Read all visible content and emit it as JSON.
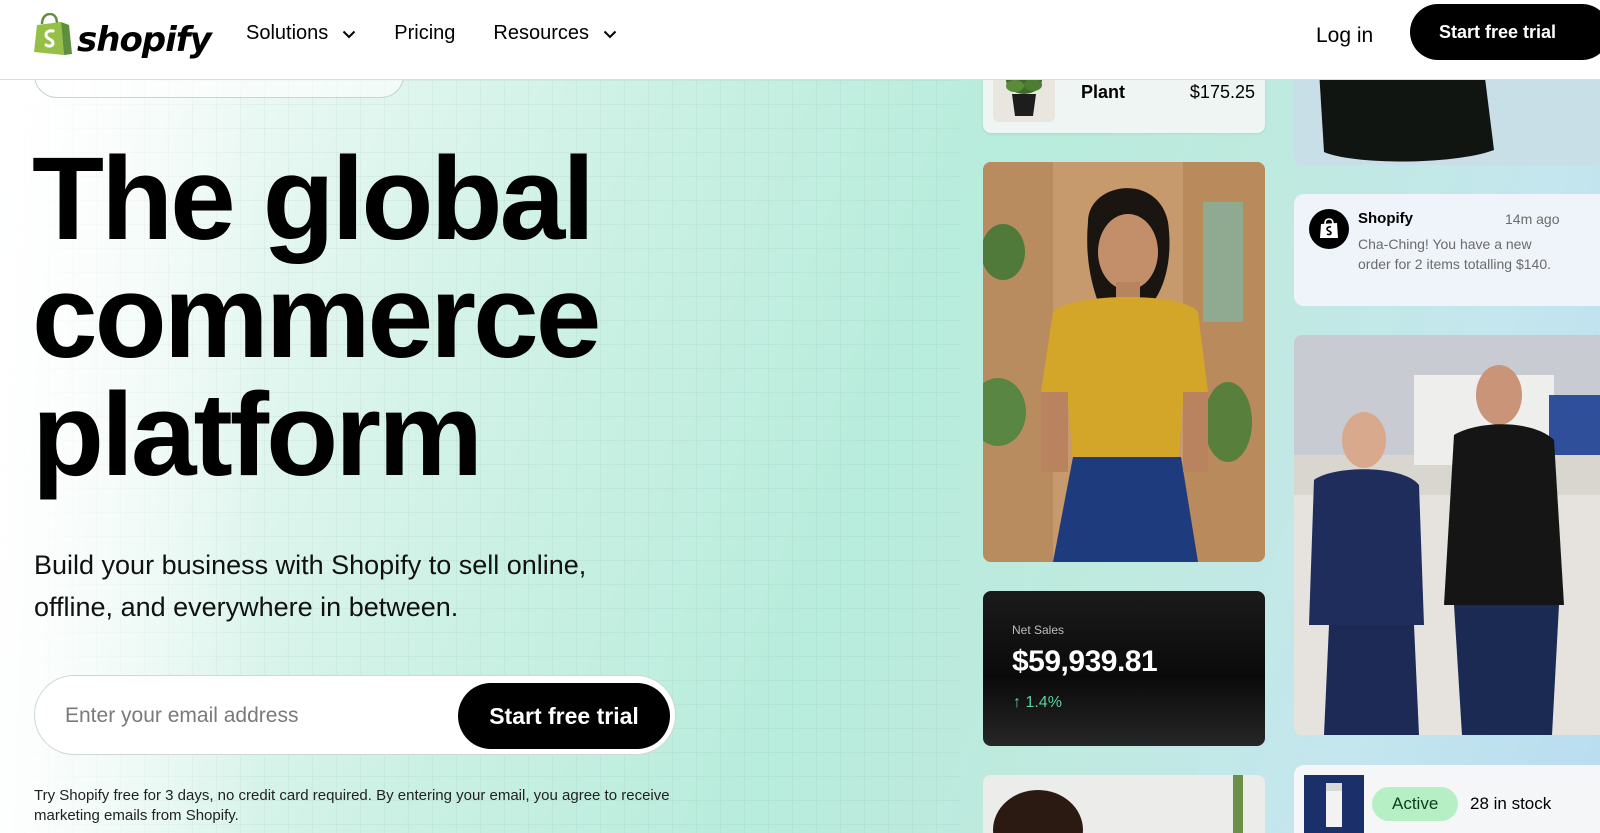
{
  "brand": {
    "name": "shopify",
    "colors": {
      "logo_green": "#95bf47",
      "logo_dark_green": "#5e8e3e",
      "primary_button": "#000000",
      "positive": "#5fd09b",
      "active_badge": "#b6efc4"
    }
  },
  "nav": {
    "items": [
      {
        "label": "Solutions",
        "has_dropdown": true
      },
      {
        "label": "Pricing",
        "has_dropdown": false
      },
      {
        "label": "Resources",
        "has_dropdown": true
      }
    ],
    "login_label": "Log in",
    "cta_label": "Start free trial"
  },
  "hero": {
    "title_lines": [
      "The global",
      "commerce",
      "platform"
    ],
    "subtitle_lines": [
      "Build your business with Shopify to sell online,",
      "offline, and everywhere in between."
    ],
    "email_placeholder": "Enter your email address",
    "email_value": "",
    "cta_label": "Start free trial",
    "disclaimer": "Try Shopify free for 3 days, no credit card required. By entering your email, you agree to receive marketing emails from Shopify."
  },
  "cards": {
    "product": {
      "name": "Plant",
      "price": "$175.25"
    },
    "notification": {
      "sender": "Shopify",
      "time": "14m ago",
      "message": "Cha-Ching! You have a new order for 2 items totalling $140."
    },
    "net_sales": {
      "label": "Net Sales",
      "value": "$59,939.81",
      "change": "1.4%"
    },
    "inventory": {
      "status": "Active",
      "stock": "28 in stock"
    }
  },
  "icons": [
    "shopify-bag-icon",
    "chevron-down-icon",
    "arrow-up-icon"
  ]
}
